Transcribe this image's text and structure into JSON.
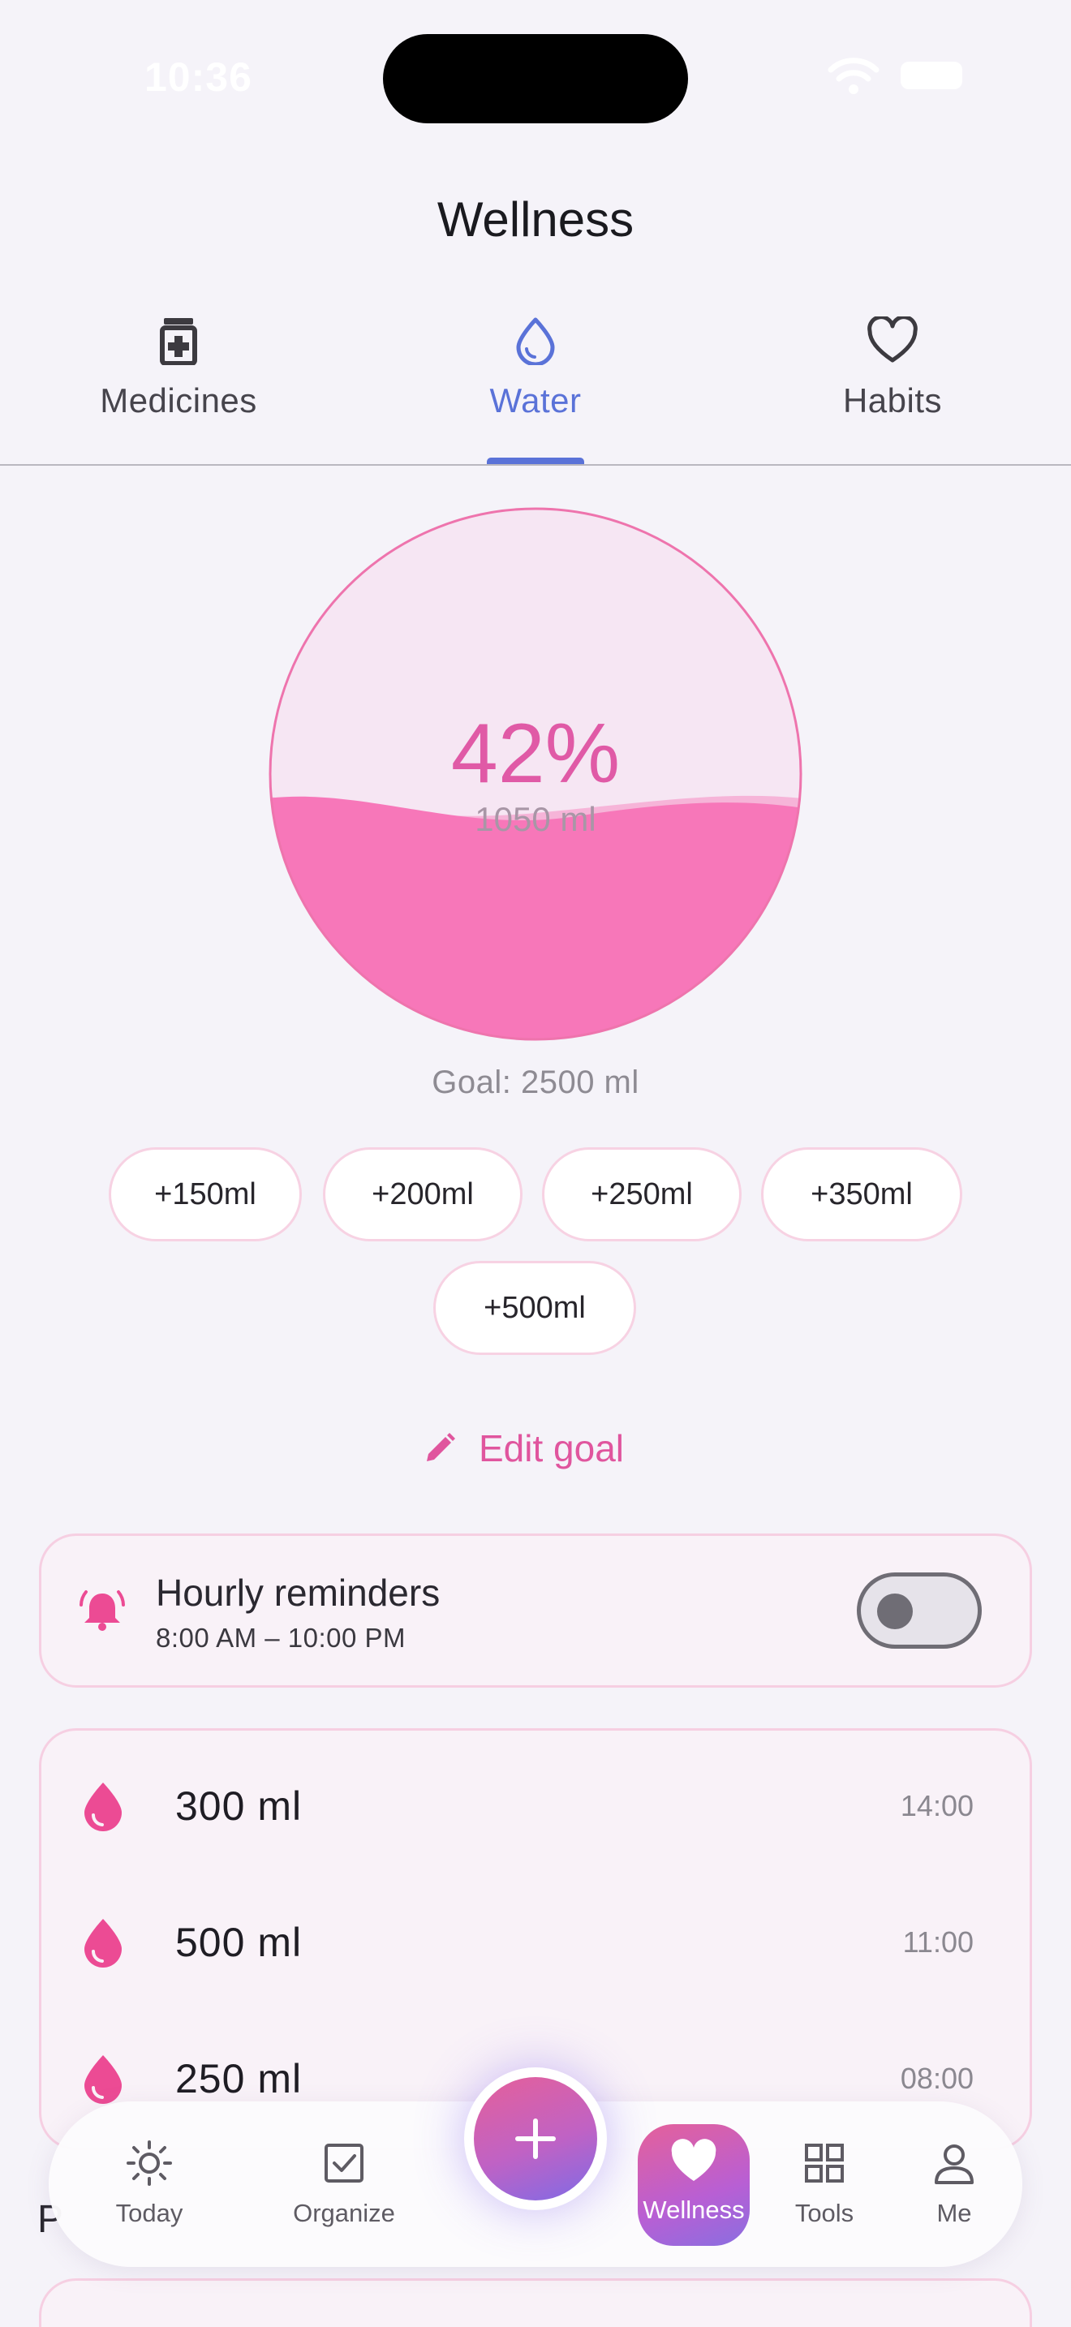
{
  "status_bar": {
    "time": "10:36"
  },
  "header": {
    "title": "Wellness"
  },
  "tabs": [
    {
      "label": "Medicines",
      "icon": "medicine-bottle-icon",
      "active": false
    },
    {
      "label": "Water",
      "icon": "water-drop-icon",
      "active": true
    },
    {
      "label": "Habits",
      "icon": "heart-outline-icon",
      "active": false
    }
  ],
  "water": {
    "percent_label": "42%",
    "amount_label": "1050 ml",
    "fill_fraction": 0.42,
    "goal_label": "Goal: 2500 ml",
    "colors": {
      "fill": "#f777b9",
      "wave": "#f6a3cf",
      "empty": "#f6e6f3",
      "ring": "#ee74ad"
    }
  },
  "quick_add": [
    "+150ml",
    "+200ml",
    "+250ml",
    "+350ml",
    "+500ml"
  ],
  "edit_goal": {
    "label": "Edit goal",
    "icon": "pencil-icon"
  },
  "reminders": {
    "title": "Hourly reminders",
    "schedule": "8:00 AM – 10:00 PM",
    "enabled": false,
    "icon": "bell-ringing-icon"
  },
  "log": [
    {
      "amount": "300 ml",
      "time": "14:00"
    },
    {
      "amount": "500 ml",
      "time": "11:00"
    },
    {
      "amount": "250 ml",
      "time": "08:00"
    }
  ],
  "partial_heading_letter": "P",
  "bottom_nav": {
    "items": [
      {
        "label": "Today",
        "icon": "sun-icon"
      },
      {
        "label": "Organize",
        "icon": "checkbox-icon"
      },
      {
        "label": "Wellness",
        "icon": "heart-filled-icon",
        "active": true
      },
      {
        "label": "Tools",
        "icon": "grid-icon"
      },
      {
        "label": "Me",
        "icon": "person-icon"
      }
    ],
    "fab_icon": "plus-icon"
  },
  "accent_colors": {
    "primary_blue": "#5a72d8",
    "pink": "#e0559e"
  }
}
